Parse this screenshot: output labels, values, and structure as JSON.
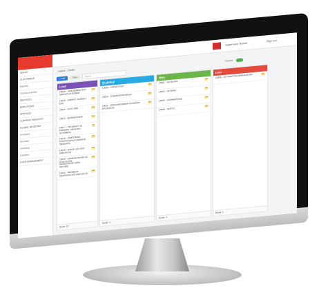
{
  "topbar": {
    "user": "Supervisor Teams",
    "logout": "Sign out"
  },
  "breadcrumb": {
    "home": "Home",
    "current": "Deals"
  },
  "toolbar": {
    "add": "+ Add",
    "filter": "Filter",
    "search_placeholder": "Search",
    "toggle_label": "Pipeline"
  },
  "sidebar": {
    "items": [
      {
        "label": "Deals",
        "style": "caps"
      },
      {
        "label": "Customers",
        "style": "caps"
      },
      {
        "label": "Reports",
        "style": "light"
      },
      {
        "label": "Contact activities",
        "style": "light"
      },
      {
        "label": "Services",
        "style": "caps"
      },
      {
        "label": "Employees",
        "style": "caps"
      },
      {
        "label": "Articles",
        "style": "caps"
      },
      {
        "label": "Company registry",
        "style": "caps"
      },
      {
        "label": "Global registry",
        "style": "caps"
      },
      {
        "label": "Company",
        "style": "light"
      },
      {
        "label": "Directory",
        "style": "light"
      },
      {
        "label": "Grouping",
        "style": "light"
      },
      {
        "label": "Category",
        "style": "light"
      },
      {
        "label": "User management",
        "style": "caps"
      }
    ]
  },
  "columns": [
    {
      "title": "Lead",
      "color": "#7b52b8",
      "footer": "Deals: 21",
      "cards": [
        {
          "text": "10019 – Zahlambda ovo sredstvo dobro",
          "badge": "NA"
        },
        {
          "text": "10019 – Energy Cabinet ES4",
          "badge": "NA"
        },
        {
          "text": "10015 – Kivu 2000",
          "badge": "NA"
        },
        {
          "text": "10014 – Bojaná kana",
          "badge": "NA"
        },
        {
          "text": "10017 – Projekat za primenu lokalnih automata",
          "badge": "AV"
        },
        {
          "text": "10018 – Smeštanje postrojenja gradnja objekata",
          "badge": "NA"
        },
        {
          "text": "10019 – Banje lek ovo sredstvo",
          "badge": "NA"
        },
        {
          "text": "10020 – Zamena ravna uz kvalitetne infrastrukturne metode",
          "badge": "NA"
        },
        {
          "text": "10021 – Promena objekata ovo sredstvo",
          "badge": "NA"
        }
      ]
    },
    {
      "title": "Qualified",
      "color": "#27a9e1",
      "footer": "Deals: 4",
      "cards": [
        {
          "text": "10009 – Offer Plan",
          "badge": "NA"
        },
        {
          "text": "10020 – Dobijeni projekat",
          "badge": "NA"
        },
        {
          "text": "10031 – Zorganizirana ustanova aplikacija",
          "badge": "NA"
        }
      ]
    },
    {
      "title": "Won",
      "color": "#6bb54a",
      "footer": "Deals: 4",
      "cards": [
        {
          "text": "10001 – 60 Ojuso",
          "badge": "NA"
        },
        {
          "text": "10002 – 8x Bana",
          "badge": "NA"
        },
        {
          "text": "10005 – Ograničenje",
          "badge": "NA"
        },
        {
          "text": "10008 – Nešto",
          "badge": "NA"
        }
      ]
    },
    {
      "title": "Lost",
      "color": "#e64a3d",
      "footer": "Deals: 1",
      "cards": [
        {
          "text": "10006 – Automotive Kragujevac",
          "badge": "NA"
        }
      ]
    }
  ]
}
